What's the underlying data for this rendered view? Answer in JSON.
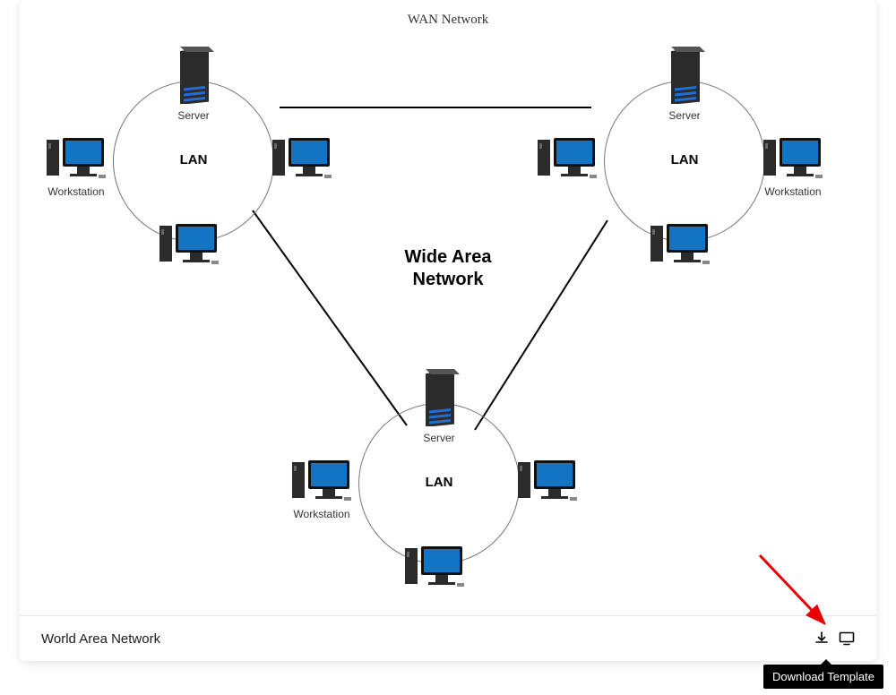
{
  "diagram": {
    "title": "WAN Network",
    "center_label_line1": "Wide Area",
    "center_label_line2": "Network",
    "server_label": "Server",
    "workstation_label": "Workstation",
    "lan_label": "LAN",
    "lans": [
      {
        "id": "lan-top-left"
      },
      {
        "id": "lan-top-right"
      },
      {
        "id": "lan-bottom"
      }
    ]
  },
  "footer": {
    "title": "World Area Network"
  },
  "tooltip": "Download Template"
}
